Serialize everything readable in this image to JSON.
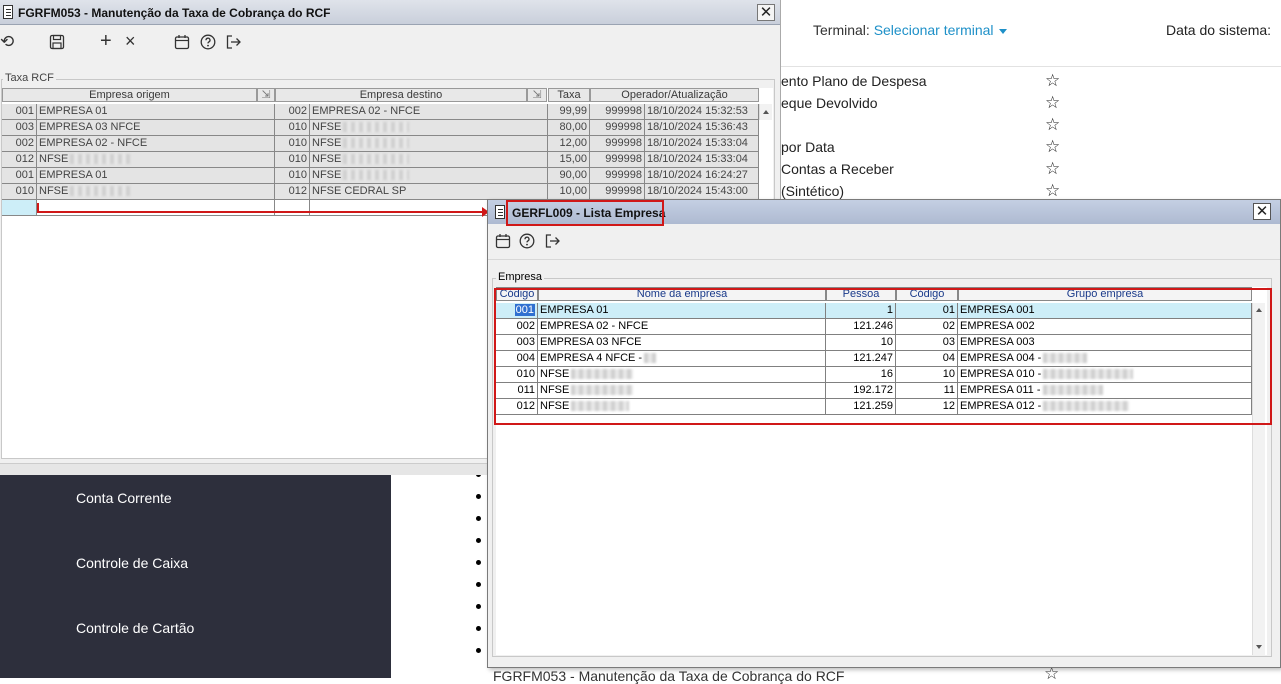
{
  "background": {
    "terminal_label": "Terminal:",
    "terminal_link": "Selecionar terminal",
    "system_date_label": "Data do sistema:",
    "favorites": [
      {
        "label": "ento Plano de Despesa"
      },
      {
        "label": "eque Devolvido"
      },
      {
        "label": ""
      },
      {
        "label": "por Data"
      },
      {
        "label": "Contas a Receber"
      },
      {
        "label": "(Sintético)"
      }
    ],
    "sidebar_items": [
      "Conta Corrente",
      "Controle de Caixa",
      "Controle de Cartão"
    ],
    "bottom_text": "FGRFM053 - Manutenção da Taxa de Cobrança do RCF"
  },
  "win1": {
    "title": "FGRFM053 - Manutenção da Taxa de Cobrança do RCF",
    "toolbar": [
      "refresh-icon",
      "save-icon",
      "add-icon",
      "delete-icon",
      "calendar-icon",
      "help-icon",
      "exit-icon"
    ],
    "group_label": "Taxa RCF",
    "columns": [
      "Empresa origem",
      "Empresa destino",
      "Taxa",
      "Operador/Atualização"
    ],
    "rows": [
      {
        "orig_code": "001",
        "orig_name": "EMPRESA 01",
        "dest_code": "002",
        "dest_name": "EMPRESA 02 - NFCE",
        "taxa": "99,99",
        "operador": "999998",
        "data": "18/10/2024 15:32:53"
      },
      {
        "orig_code": "003",
        "orig_name": "EMPRESA 03 NFCE",
        "dest_code": "010",
        "dest_name": "NFSE",
        "taxa": "80,00",
        "operador": "999998",
        "data": "18/10/2024 15:36:43"
      },
      {
        "orig_code": "002",
        "orig_name": "EMPRESA 02 - NFCE",
        "dest_code": "010",
        "dest_name": "NFSE",
        "taxa": "12,00",
        "operador": "999998",
        "data": "18/10/2024 15:33:04"
      },
      {
        "orig_code": "012",
        "orig_name": "NFSE",
        "dest_code": "010",
        "dest_name": "NFSE",
        "taxa": "15,00",
        "operador": "999998",
        "data": "18/10/2024 15:33:04"
      },
      {
        "orig_code": "001",
        "orig_name": "EMPRESA 01",
        "dest_code": "010",
        "dest_name": "NFSE",
        "taxa": "90,00",
        "operador": "999998",
        "data": "18/10/2024 16:24:27"
      },
      {
        "orig_code": "010",
        "orig_name": "NFSE",
        "dest_code": "012",
        "dest_name": "NFSE CEDRAL SP",
        "taxa": "10,00",
        "operador": "999998",
        "data": "18/10/2024 15:43:00"
      }
    ]
  },
  "win2": {
    "title": "GERFL009 - Lista Empresa",
    "toolbar": [
      "calendar-icon",
      "help-icon",
      "exit-icon"
    ],
    "group_label": "Empresa",
    "columns": [
      "Código",
      "Nome da empresa",
      "Pessoa",
      "Código",
      "Grupo empresa"
    ],
    "rows": [
      {
        "codigo": "001",
        "nome": "EMPRESA 01",
        "pessoa": "1",
        "cod_grupo": "01",
        "grupo": "EMPRESA 001"
      },
      {
        "codigo": "002",
        "nome": "EMPRESA 02 - NFCE",
        "pessoa": "121.246",
        "cod_grupo": "02",
        "grupo": "EMPRESA 002"
      },
      {
        "codigo": "003",
        "nome": "EMPRESA 03 NFCE",
        "pessoa": "10",
        "cod_grupo": "03",
        "grupo": "EMPRESA 003"
      },
      {
        "codigo": "004",
        "nome": "EMPRESA 4 NFCE -",
        "pessoa": "121.247",
        "cod_grupo": "04",
        "grupo": "EMPRESA 004 -"
      },
      {
        "codigo": "010",
        "nome": "NFSE",
        "pessoa": "16",
        "cod_grupo": "10",
        "grupo": "EMPRESA 010 -"
      },
      {
        "codigo": "011",
        "nome": "NFSE",
        "pessoa": "192.172",
        "cod_grupo": "11",
        "grupo": "EMPRESA 011 -"
      },
      {
        "codigo": "012",
        "nome": "NFSE",
        "pessoa": "121.259",
        "cod_grupo": "12",
        "grupo": "EMPRESA 012 -"
      }
    ]
  },
  "colors": {
    "highlight": "#d01818",
    "selected_row": "#cdeef8",
    "sidebar_bg": "#2d2f3c",
    "link": "#1e90c8"
  }
}
